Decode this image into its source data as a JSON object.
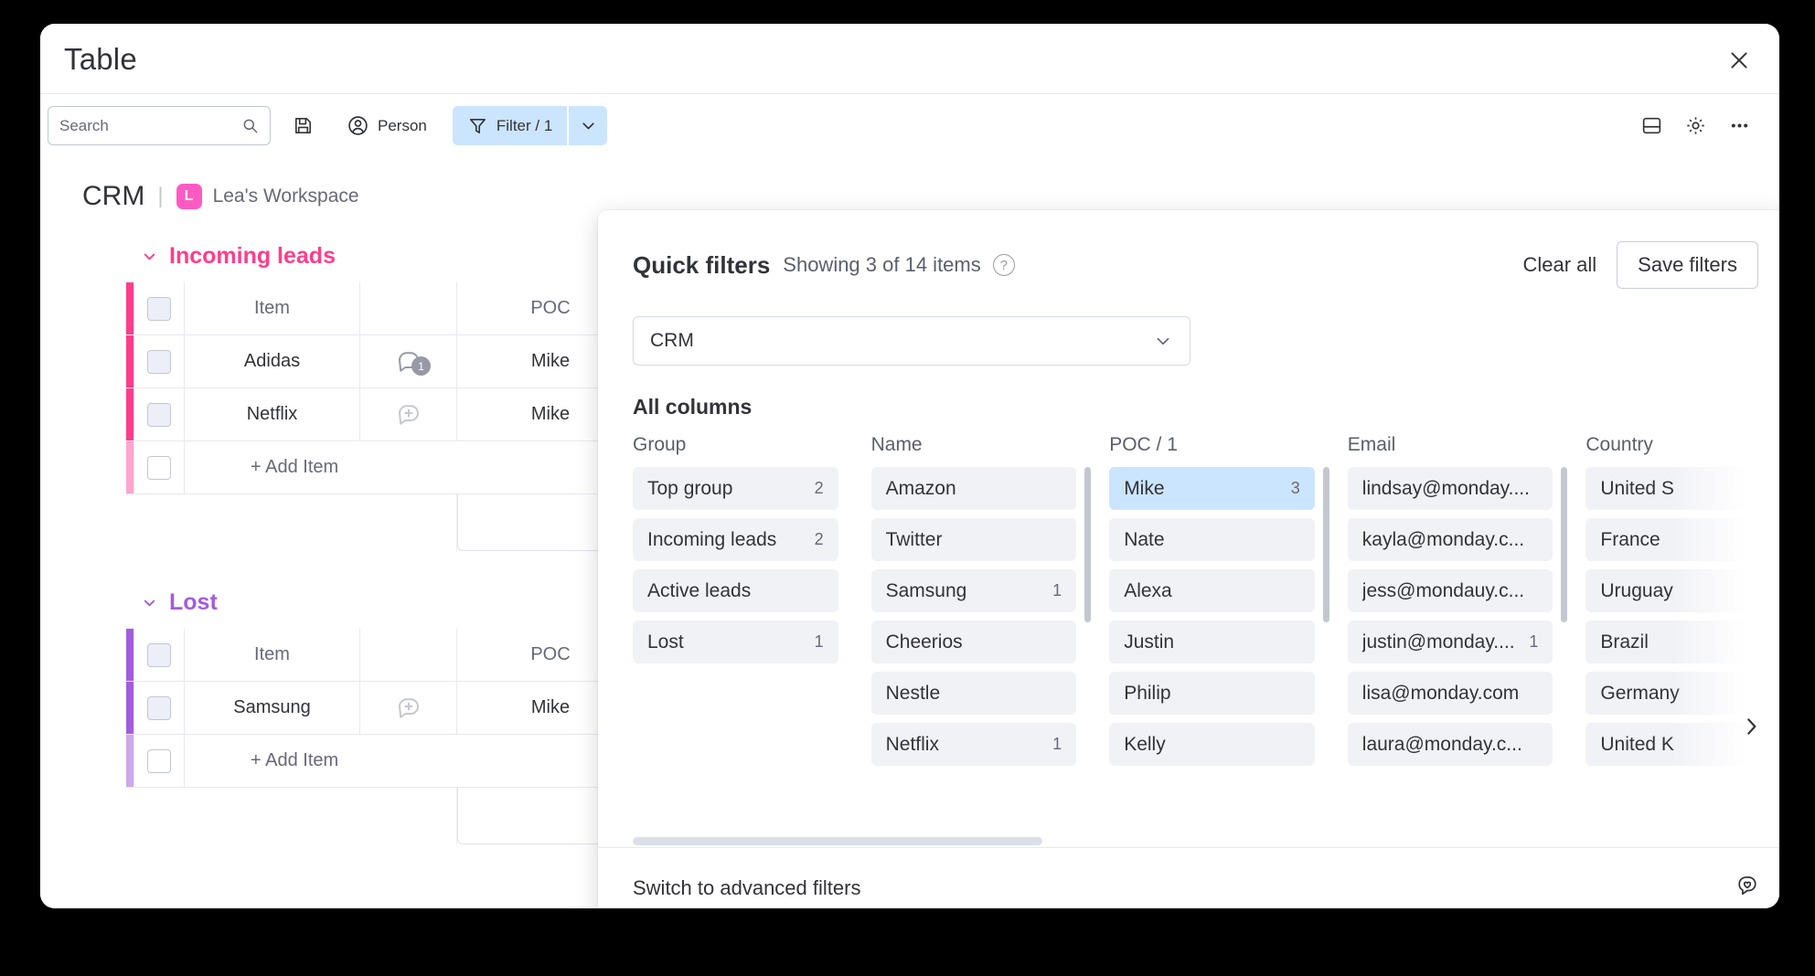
{
  "window": {
    "title": "Table",
    "close_label": "×"
  },
  "toolbar": {
    "search": {
      "placeholder": "Search",
      "value": "",
      "icon": "search-icon"
    },
    "save_icon": "floppy-disk-icon",
    "person_label": "Person",
    "person_icon": "person-circle-icon",
    "filter_label": "Filter / 1",
    "filter_icon": "funnel-icon",
    "filter_caret_icon": "chevron-down-icon",
    "right_icons": [
      "split-view-icon",
      "gear-icon",
      "ellipsis-icon"
    ]
  },
  "board": {
    "name": "CRM",
    "separator": "|",
    "workspace_initial": "L",
    "workspace_name": "Lea's Workspace",
    "workspace_color": "#ff5ac4",
    "groups": [
      {
        "title": "Incoming leads",
        "color": "#ff3d8a",
        "collapse_icon": "chevron-down-icon",
        "columns": [
          "Item",
          "POC"
        ],
        "rows": [
          {
            "item": "Adidas",
            "poc": "Mike",
            "chat_icon": "chat-bubble-icon",
            "chat_count": "1"
          },
          {
            "item": "Netflix",
            "poc": "Mike",
            "chat_icon": "chat-add-icon",
            "chat_count": ""
          }
        ],
        "add_item_label": "+ Add Item"
      },
      {
        "title": "Lost",
        "color": "#a25ddc",
        "collapse_icon": "chevron-down-icon",
        "columns": [
          "Item",
          "POC"
        ],
        "rows": [
          {
            "item": "Samsung",
            "poc": "Mike",
            "chat_icon": "chat-add-icon",
            "chat_count": ""
          }
        ],
        "add_item_label": "+ Add Item"
      }
    ],
    "status_colors": {
      "red": "#e8696a",
      "orange": "#eda13f"
    }
  },
  "filters_panel": {
    "title": "Quick filters",
    "subtitle": "Showing 3 of 14 items",
    "help_icon": "question-mark-icon",
    "clear_all_label": "Clear all",
    "save_filters_label": "Save filters",
    "board_select": {
      "value": "CRM",
      "caret_icon": "chevron-down-icon"
    },
    "section_label": "All columns",
    "next_columns_icon": "chevron-right-icon",
    "columns": [
      {
        "title": "Group",
        "options": [
          {
            "label": "Top group",
            "count": "2",
            "selected": false
          },
          {
            "label": "Incoming leads",
            "count": "2",
            "selected": false
          },
          {
            "label": "Active leads",
            "count": "",
            "selected": false
          },
          {
            "label": "Lost",
            "count": "1",
            "selected": false
          }
        ]
      },
      {
        "title": "Name",
        "options": [
          {
            "label": "Amazon",
            "count": "",
            "selected": false
          },
          {
            "label": "Twitter",
            "count": "",
            "selected": false
          },
          {
            "label": "Samsung",
            "count": "1",
            "selected": false
          },
          {
            "label": "Cheerios",
            "count": "",
            "selected": false
          },
          {
            "label": "Nestle",
            "count": "",
            "selected": false
          },
          {
            "label": "Netflix",
            "count": "1",
            "selected": false
          }
        ]
      },
      {
        "title": "POC / 1",
        "options": [
          {
            "label": "Mike",
            "count": "3",
            "selected": true
          },
          {
            "label": "Nate",
            "count": "",
            "selected": false
          },
          {
            "label": "Alexa",
            "count": "",
            "selected": false
          },
          {
            "label": "Justin",
            "count": "",
            "selected": false
          },
          {
            "label": "Philip",
            "count": "",
            "selected": false
          },
          {
            "label": "Kelly",
            "count": "",
            "selected": false
          }
        ]
      },
      {
        "title": "Email",
        "options": [
          {
            "label": "lindsay@monday....",
            "count": "",
            "selected": false
          },
          {
            "label": "kayla@monday.c...",
            "count": "",
            "selected": false
          },
          {
            "label": "jess@mondauy.c...",
            "count": "",
            "selected": false
          },
          {
            "label": "justin@monday....",
            "count": "1",
            "selected": false
          },
          {
            "label": "lisa@monday.com",
            "count": "",
            "selected": false
          },
          {
            "label": "laura@monday.c...",
            "count": "",
            "selected": false
          }
        ]
      },
      {
        "title": "Country",
        "options": [
          {
            "label": "United S",
            "count": "",
            "selected": false
          },
          {
            "label": "France",
            "count": "",
            "selected": false
          },
          {
            "label": "Uruguay",
            "count": "",
            "selected": false
          },
          {
            "label": "Brazil",
            "count": "",
            "selected": false
          },
          {
            "label": "Germany",
            "count": "",
            "selected": false
          },
          {
            "label": "United K",
            "count": "",
            "selected": false
          }
        ]
      }
    ],
    "footer": {
      "advanced_link": "Switch to advanced filters",
      "feedback_icon": "feedback-heart-icon"
    }
  }
}
